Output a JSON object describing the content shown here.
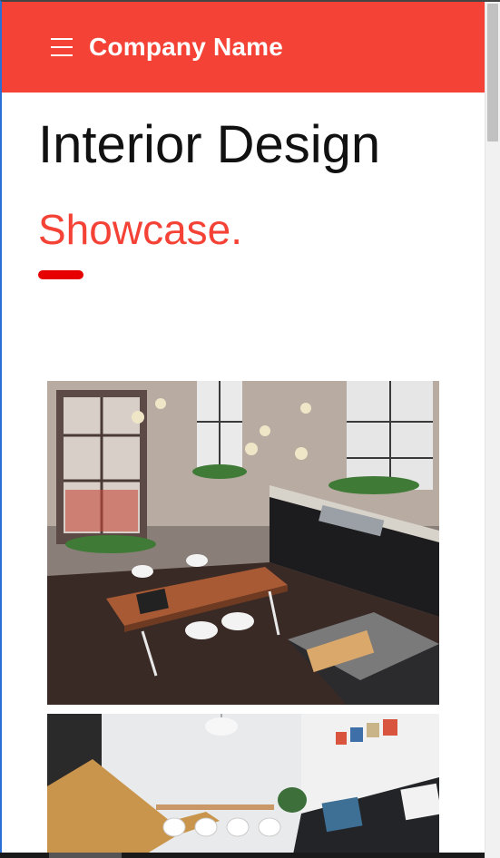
{
  "header": {
    "brand": "Company Name",
    "menu_icon": "hamburger-menu-icon",
    "background_color": "#f44336"
  },
  "hero": {
    "title": "Interior Design",
    "subtitle": "Showcase.",
    "accent_color": "#f44336",
    "divider_color": "#e60000"
  },
  "gallery": {
    "images": [
      {
        "subject": "loft kitchen with brick walls, large windows and wooden dining table"
      },
      {
        "subject": "bright living room with wooden chair, dining set and dark sofa"
      }
    ]
  }
}
